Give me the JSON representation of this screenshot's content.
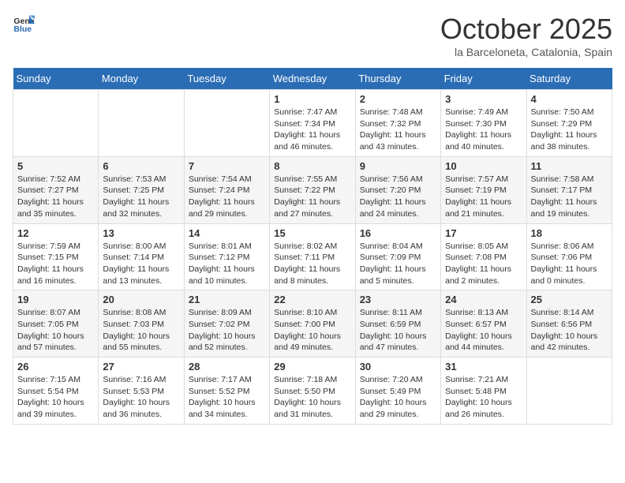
{
  "header": {
    "logo_general": "General",
    "logo_blue": "Blue",
    "month": "October 2025",
    "location": "la Barceloneta, Catalonia, Spain"
  },
  "days_of_week": [
    "Sunday",
    "Monday",
    "Tuesday",
    "Wednesday",
    "Thursday",
    "Friday",
    "Saturday"
  ],
  "weeks": [
    [
      {
        "day": "",
        "info": ""
      },
      {
        "day": "",
        "info": ""
      },
      {
        "day": "",
        "info": ""
      },
      {
        "day": "1",
        "info": "Sunrise: 7:47 AM\nSunset: 7:34 PM\nDaylight: 11 hours and 46 minutes."
      },
      {
        "day": "2",
        "info": "Sunrise: 7:48 AM\nSunset: 7:32 PM\nDaylight: 11 hours and 43 minutes."
      },
      {
        "day": "3",
        "info": "Sunrise: 7:49 AM\nSunset: 7:30 PM\nDaylight: 11 hours and 40 minutes."
      },
      {
        "day": "4",
        "info": "Sunrise: 7:50 AM\nSunset: 7:29 PM\nDaylight: 11 hours and 38 minutes."
      }
    ],
    [
      {
        "day": "5",
        "info": "Sunrise: 7:52 AM\nSunset: 7:27 PM\nDaylight: 11 hours and 35 minutes."
      },
      {
        "day": "6",
        "info": "Sunrise: 7:53 AM\nSunset: 7:25 PM\nDaylight: 11 hours and 32 minutes."
      },
      {
        "day": "7",
        "info": "Sunrise: 7:54 AM\nSunset: 7:24 PM\nDaylight: 11 hours and 29 minutes."
      },
      {
        "day": "8",
        "info": "Sunrise: 7:55 AM\nSunset: 7:22 PM\nDaylight: 11 hours and 27 minutes."
      },
      {
        "day": "9",
        "info": "Sunrise: 7:56 AM\nSunset: 7:20 PM\nDaylight: 11 hours and 24 minutes."
      },
      {
        "day": "10",
        "info": "Sunrise: 7:57 AM\nSunset: 7:19 PM\nDaylight: 11 hours and 21 minutes."
      },
      {
        "day": "11",
        "info": "Sunrise: 7:58 AM\nSunset: 7:17 PM\nDaylight: 11 hours and 19 minutes."
      }
    ],
    [
      {
        "day": "12",
        "info": "Sunrise: 7:59 AM\nSunset: 7:15 PM\nDaylight: 11 hours and 16 minutes."
      },
      {
        "day": "13",
        "info": "Sunrise: 8:00 AM\nSunset: 7:14 PM\nDaylight: 11 hours and 13 minutes."
      },
      {
        "day": "14",
        "info": "Sunrise: 8:01 AM\nSunset: 7:12 PM\nDaylight: 11 hours and 10 minutes."
      },
      {
        "day": "15",
        "info": "Sunrise: 8:02 AM\nSunset: 7:11 PM\nDaylight: 11 hours and 8 minutes."
      },
      {
        "day": "16",
        "info": "Sunrise: 8:04 AM\nSunset: 7:09 PM\nDaylight: 11 hours and 5 minutes."
      },
      {
        "day": "17",
        "info": "Sunrise: 8:05 AM\nSunset: 7:08 PM\nDaylight: 11 hours and 2 minutes."
      },
      {
        "day": "18",
        "info": "Sunrise: 8:06 AM\nSunset: 7:06 PM\nDaylight: 11 hours and 0 minutes."
      }
    ],
    [
      {
        "day": "19",
        "info": "Sunrise: 8:07 AM\nSunset: 7:05 PM\nDaylight: 10 hours and 57 minutes."
      },
      {
        "day": "20",
        "info": "Sunrise: 8:08 AM\nSunset: 7:03 PM\nDaylight: 10 hours and 55 minutes."
      },
      {
        "day": "21",
        "info": "Sunrise: 8:09 AM\nSunset: 7:02 PM\nDaylight: 10 hours and 52 minutes."
      },
      {
        "day": "22",
        "info": "Sunrise: 8:10 AM\nSunset: 7:00 PM\nDaylight: 10 hours and 49 minutes."
      },
      {
        "day": "23",
        "info": "Sunrise: 8:11 AM\nSunset: 6:59 PM\nDaylight: 10 hours and 47 minutes."
      },
      {
        "day": "24",
        "info": "Sunrise: 8:13 AM\nSunset: 6:57 PM\nDaylight: 10 hours and 44 minutes."
      },
      {
        "day": "25",
        "info": "Sunrise: 8:14 AM\nSunset: 6:56 PM\nDaylight: 10 hours and 42 minutes."
      }
    ],
    [
      {
        "day": "26",
        "info": "Sunrise: 7:15 AM\nSunset: 5:54 PM\nDaylight: 10 hours and 39 minutes."
      },
      {
        "day": "27",
        "info": "Sunrise: 7:16 AM\nSunset: 5:53 PM\nDaylight: 10 hours and 36 minutes."
      },
      {
        "day": "28",
        "info": "Sunrise: 7:17 AM\nSunset: 5:52 PM\nDaylight: 10 hours and 34 minutes."
      },
      {
        "day": "29",
        "info": "Sunrise: 7:18 AM\nSunset: 5:50 PM\nDaylight: 10 hours and 31 minutes."
      },
      {
        "day": "30",
        "info": "Sunrise: 7:20 AM\nSunset: 5:49 PM\nDaylight: 10 hours and 29 minutes."
      },
      {
        "day": "31",
        "info": "Sunrise: 7:21 AM\nSunset: 5:48 PM\nDaylight: 10 hours and 26 minutes."
      },
      {
        "day": "",
        "info": ""
      }
    ]
  ]
}
